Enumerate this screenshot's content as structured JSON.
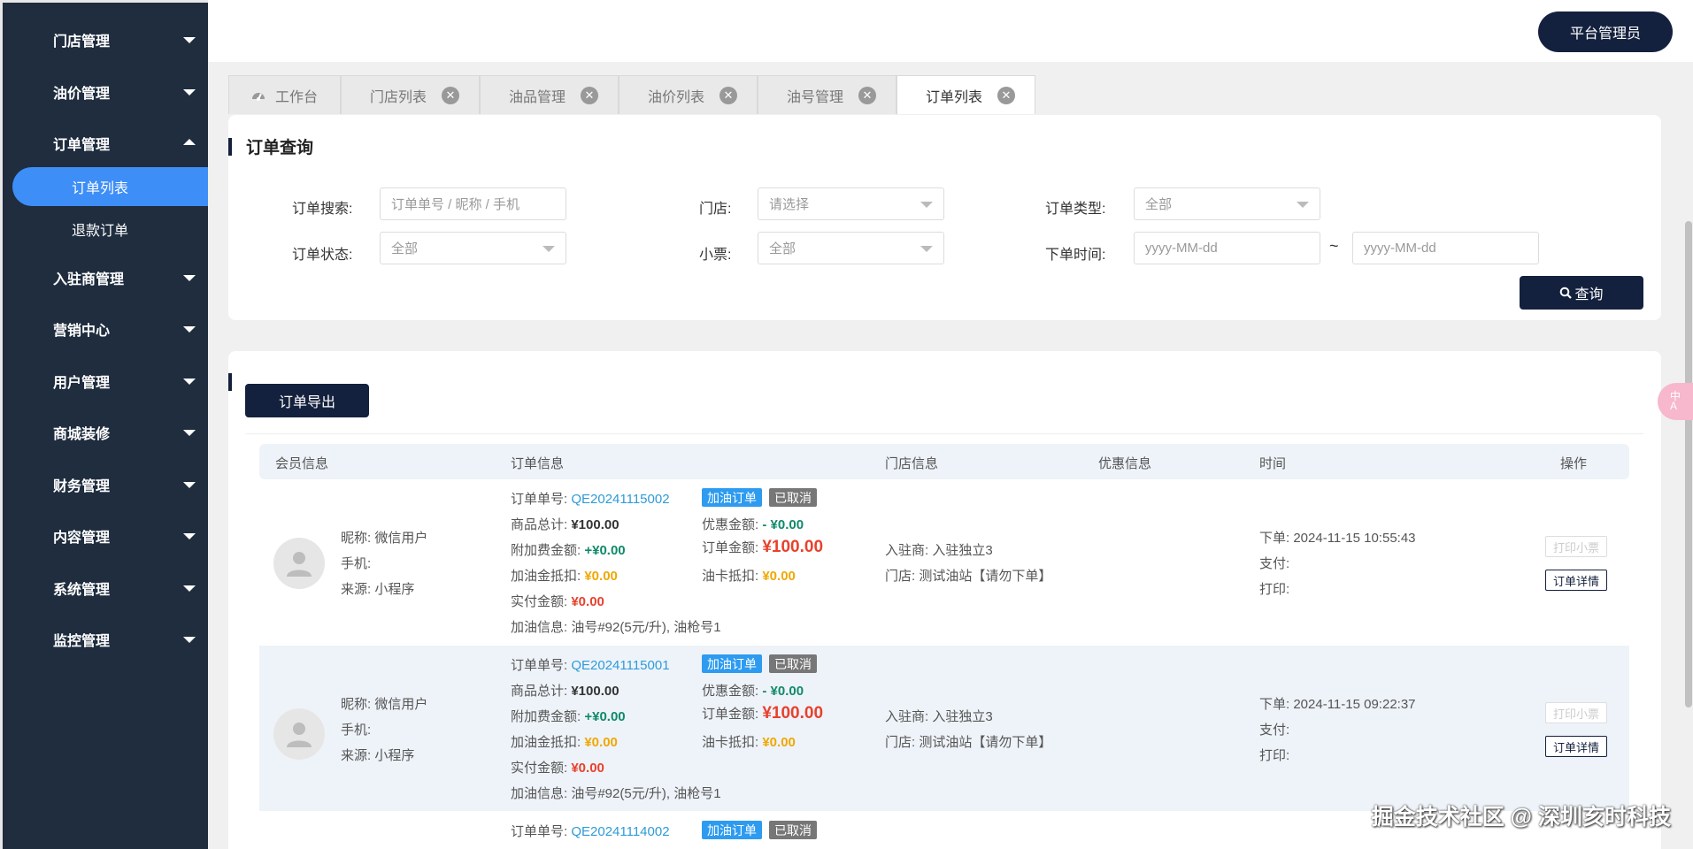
{
  "sidebar": {
    "items": [
      {
        "label": "门店管理"
      },
      {
        "label": "油价管理"
      },
      {
        "label": "订单管理"
      },
      {
        "label": "入驻商管理"
      },
      {
        "label": "营销中心"
      },
      {
        "label": "用户管理"
      },
      {
        "label": "商城装修"
      },
      {
        "label": "财务管理"
      },
      {
        "label": "内容管理"
      },
      {
        "label": "系统管理"
      },
      {
        "label": "监控管理"
      }
    ],
    "sub_items": [
      {
        "label": "订单列表"
      },
      {
        "label": "退款订单"
      }
    ]
  },
  "header": {
    "admin_label": "平台管理员"
  },
  "tabs": [
    {
      "label": "工作台"
    },
    {
      "label": "门店列表"
    },
    {
      "label": "油品管理"
    },
    {
      "label": "油价列表"
    },
    {
      "label": "油号管理"
    },
    {
      "label": "订单列表"
    }
  ],
  "search": {
    "title": "订单查询",
    "order_search_label": "订单搜索:",
    "order_search_placeholder": "订单单号 / 昵称 / 手机",
    "store_label": "门店:",
    "store_value": "请选择",
    "order_type_label": "订单类型:",
    "order_type_value": "全部",
    "order_status_label": "订单状态:",
    "order_status_value": "全部",
    "receipt_label": "小票:",
    "receipt_value": "全部",
    "order_time_label": "下单时间:",
    "date_from_placeholder": "yyyy-MM-dd",
    "date_sep": "~",
    "date_to_placeholder": "yyyy-MM-dd",
    "query_label": "查询"
  },
  "list": {
    "export_label": "订单导出",
    "columns": [
      "会员信息",
      "订单信息",
      "门店信息",
      "优惠信息",
      "时间",
      "操作"
    ],
    "labels": {
      "nickname": "昵称:",
      "phone": "手机:",
      "source": "来源:",
      "order_no": "订单单号:",
      "goods_total": "商品总计:",
      "extra_fee": "附加费金额:",
      "fuel_credit": "加油金抵扣:",
      "paid": "实付金额:",
      "fuel_info": "加油信息:",
      "discount": "优惠金额:",
      "order_amount": "订单金额:",
      "card_deduct": "油卡抵扣:",
      "merchant": "入驻商:",
      "store": "门店:",
      "order_time": "下单:",
      "pay_time": "支付:",
      "print_time": "打印:",
      "print_btn": "打印小票",
      "detail_btn": "订单详情"
    },
    "rows": [
      {
        "nickname": "微信用户",
        "source": "小程序",
        "order_no": "QE20241115002",
        "type_badge": "加油订单",
        "status_badge": "已取消",
        "goods_total": "¥100.00",
        "extra_fee": "+¥0.00",
        "fuel_credit": "¥0.00",
        "paid": "¥0.00",
        "fuel_info": "油号#92(5元/升), 油枪号1",
        "discount": "- ¥0.00",
        "order_amount": "¥100.00",
        "card_deduct": "¥0.00",
        "merchant": "入驻独立3",
        "store": "测试油站【请勿下单】",
        "order_time": "2024-11-15 10:55:43"
      },
      {
        "nickname": "微信用户",
        "source": "小程序",
        "order_no": "QE20241115001",
        "type_badge": "加油订单",
        "status_badge": "已取消",
        "goods_total": "¥100.00",
        "extra_fee": "+¥0.00",
        "fuel_credit": "¥0.00",
        "paid": "¥0.00",
        "fuel_info": "油号#92(5元/升), 油枪号1",
        "discount": "- ¥0.00",
        "order_amount": "¥100.00",
        "card_deduct": "¥0.00",
        "merchant": "入驻独立3",
        "store": "测试油站【请勿下单】",
        "order_time": "2024-11-15 09:22:37"
      },
      {
        "order_no": "QE20241114002",
        "type_badge": "加油订单",
        "status_badge": "已取消"
      }
    ]
  },
  "float_label": "中\nA",
  "watermark": "掘金技术社区 @ 深圳亥时科技",
  "colors": {
    "sidebar_bg": "#1f2d3f",
    "active": "#3e8ef7",
    "primary": "#14213e",
    "price_red": "#e8412c",
    "discount_green": "#0f8a6a",
    "credit_orange": "#f0a800"
  }
}
